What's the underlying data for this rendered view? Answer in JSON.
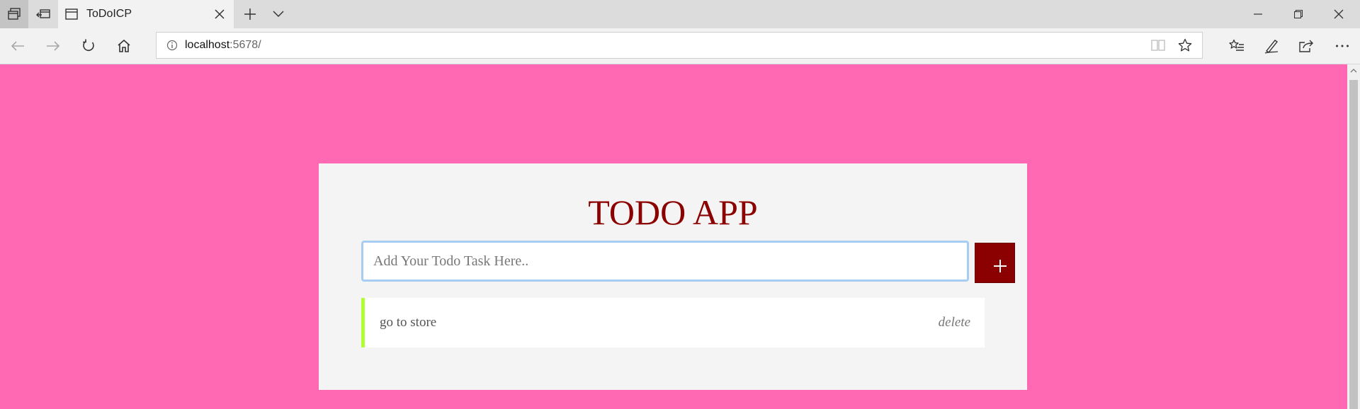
{
  "browser": {
    "tab": {
      "title": "ToDoICP",
      "favicon": "page-icon"
    },
    "address": {
      "host": "localhost",
      "port_path": ":5678/",
      "info_icon": "info-icon"
    },
    "icons": {
      "tab_actions": "tab-actions-icon",
      "tab_aside": "tabs-aside-icon",
      "new_tab": "plus-icon",
      "tab_list": "chevron-down-icon",
      "minimize": "minimize-icon",
      "restore": "restore-icon",
      "close": "close-icon",
      "back": "back-arrow-icon",
      "forward": "forward-arrow-icon",
      "refresh": "refresh-icon",
      "home": "home-icon",
      "reading_view": "reading-view-icon",
      "favorite": "star-icon",
      "favorites_hub": "favorites-hub-icon",
      "pen": "pen-icon",
      "share": "share-icon",
      "more": "more-icon"
    }
  },
  "app": {
    "title": "TODO APP",
    "input": {
      "placeholder": "Add Your Todo Task Here..",
      "value": ""
    },
    "add_button_icon": "plus-icon",
    "todos": [
      {
        "text": "go to store",
        "delete_label": "delete"
      }
    ]
  },
  "colors": {
    "page_background": "#ff69b4",
    "card_background": "#f4f4f4",
    "title": "#8b0000",
    "add_button": "#8b0000",
    "todo_accent": "#adff2f",
    "input_focus_border": "#a7cdf3"
  }
}
